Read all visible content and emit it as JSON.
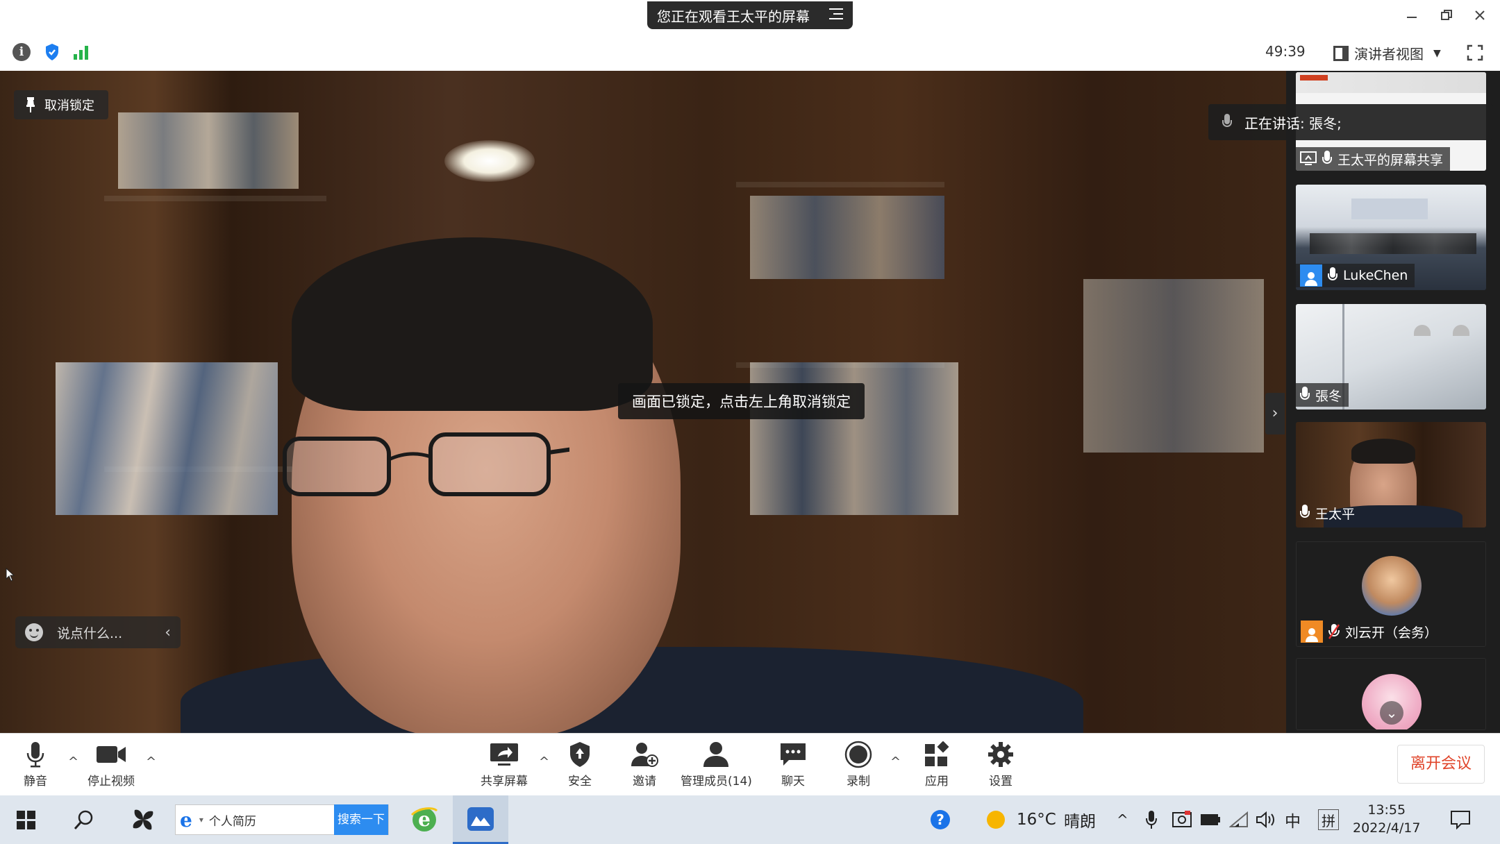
{
  "window": {
    "share_banner": "您正在观看王太平的屏幕",
    "timer": "49:39",
    "view_mode": "演讲者视图"
  },
  "main": {
    "unpin_label": "取消锁定",
    "lock_toast": "画面已锁定，点击左上角取消锁定",
    "reaction_placeholder": "说点什么..."
  },
  "panel": {
    "speaking_label": "正在讲话: 張冬;",
    "participants": [
      {
        "name": "王太平的屏幕共享",
        "kind": "screen-share"
      },
      {
        "name": "LukeChen",
        "kind": "video"
      },
      {
        "name": "張冬",
        "kind": "video"
      },
      {
        "name": "王太平",
        "kind": "video"
      },
      {
        "name": "刘云开（会务）",
        "kind": "avatar"
      }
    ]
  },
  "toolbar": {
    "mute": "静音",
    "stop_video": "停止视频",
    "share_screen": "共享屏幕",
    "security": "安全",
    "invite": "邀请",
    "manage_members": "管理成员(14)",
    "chat": "聊天",
    "record": "录制",
    "apps": "应用",
    "settings": "设置",
    "leave": "离开会议"
  },
  "taskbar": {
    "search_text": "个人简历",
    "search_button": "搜索一下",
    "weather_temp": "16°C",
    "weather_desc": "晴朗",
    "ime_lang": "中",
    "ime_mode": "拼",
    "time": "13:55",
    "date": "2022/4/17"
  },
  "colors": {
    "leave_red": "#e0442a",
    "signal_green": "#25b34a",
    "avatar_blue": "#2d8cf0",
    "avatar_orange": "#f08a24"
  }
}
